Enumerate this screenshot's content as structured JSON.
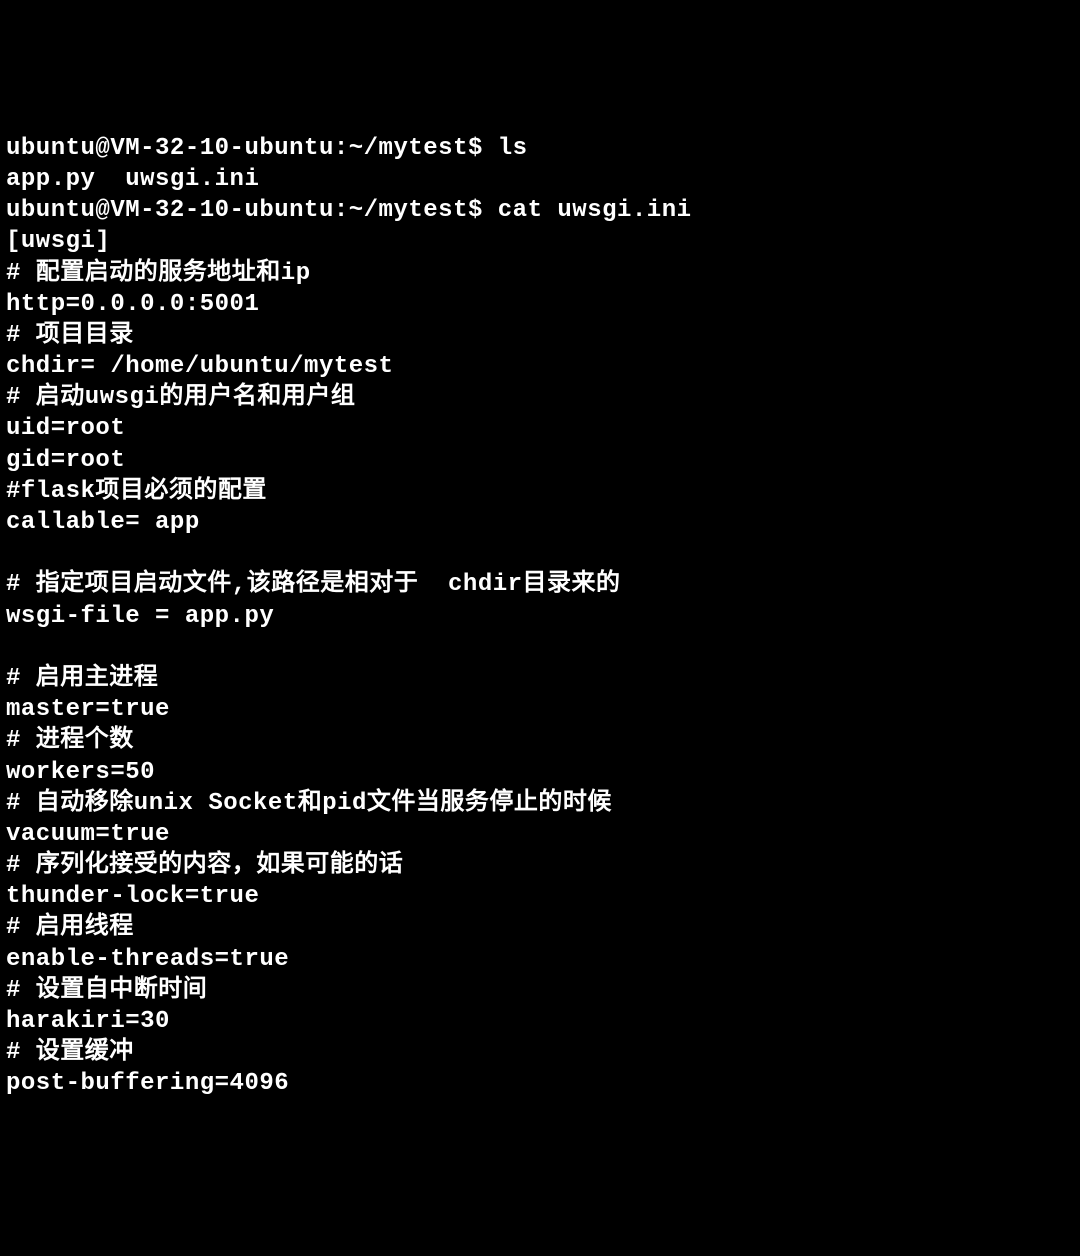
{
  "terminal": {
    "lines": [
      "ubuntu@VM-32-10-ubuntu:~/mytest$ ls",
      "app.py  uwsgi.ini",
      "ubuntu@VM-32-10-ubuntu:~/mytest$ cat uwsgi.ini",
      "[uwsgi]",
      "# 配置启动的服务地址和ip",
      "http=0.0.0.0:5001",
      "# 项目目录",
      "chdir= /home/ubuntu/mytest",
      "# 启动uwsgi的用户名和用户组",
      "uid=root",
      "gid=root",
      "#flask项目必须的配置",
      "callable= app",
      "",
      "# 指定项目启动文件,该路径是相对于  chdir目录来的",
      "wsgi-file = app.py",
      "",
      "# 启用主进程",
      "master=true",
      "# 进程个数",
      "workers=50",
      "# 自动移除unix Socket和pid文件当服务停止的时候",
      "vacuum=true",
      "# 序列化接受的内容，如果可能的话",
      "thunder-lock=true",
      "# 启用线程",
      "enable-threads=true",
      "# 设置自中断时间",
      "harakiri=30",
      "# 设置缓冲",
      "post-buffering=4096"
    ]
  }
}
